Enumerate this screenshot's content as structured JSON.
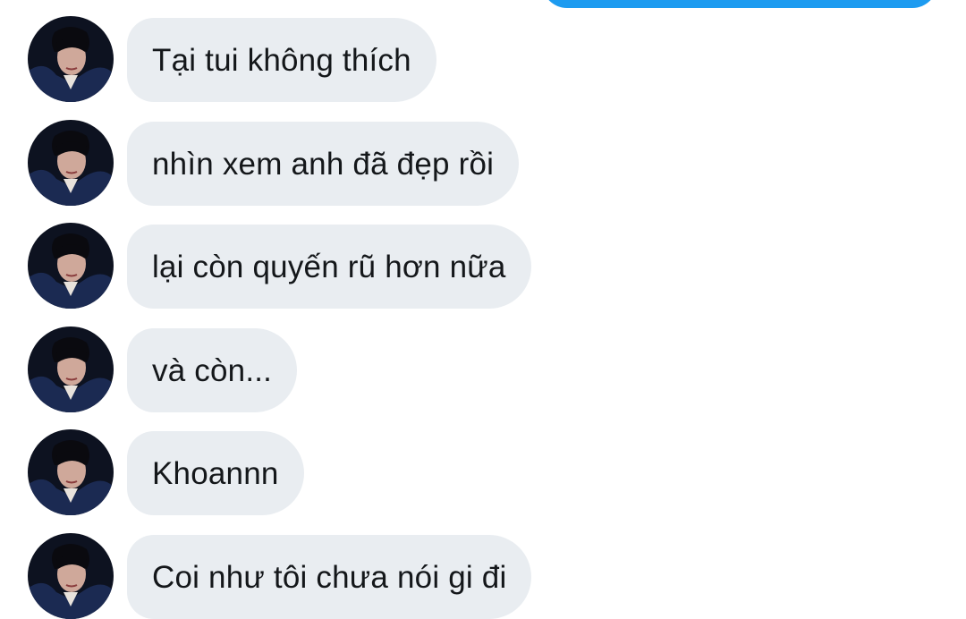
{
  "colors": {
    "background": "#ffffff",
    "sent_bubble": "#1d9bf0",
    "received_bubble": "#e9edf1",
    "text": "#14171a"
  },
  "conversation": {
    "received_messages": [
      {
        "text": "Tại tui không thích",
        "avatar": "profile-photo"
      },
      {
        "text": "nhìn xem anh đã đẹp rồi",
        "avatar": "profile-photo"
      },
      {
        "text": "lại còn quyến rũ hơn nữa",
        "avatar": "profile-photo"
      },
      {
        "text": "và còn...",
        "avatar": "profile-photo"
      },
      {
        "text": "Khoannn",
        "avatar": "profile-photo"
      },
      {
        "text": "Coi như tôi chưa nói gi đi",
        "avatar": "profile-photo"
      }
    ]
  }
}
